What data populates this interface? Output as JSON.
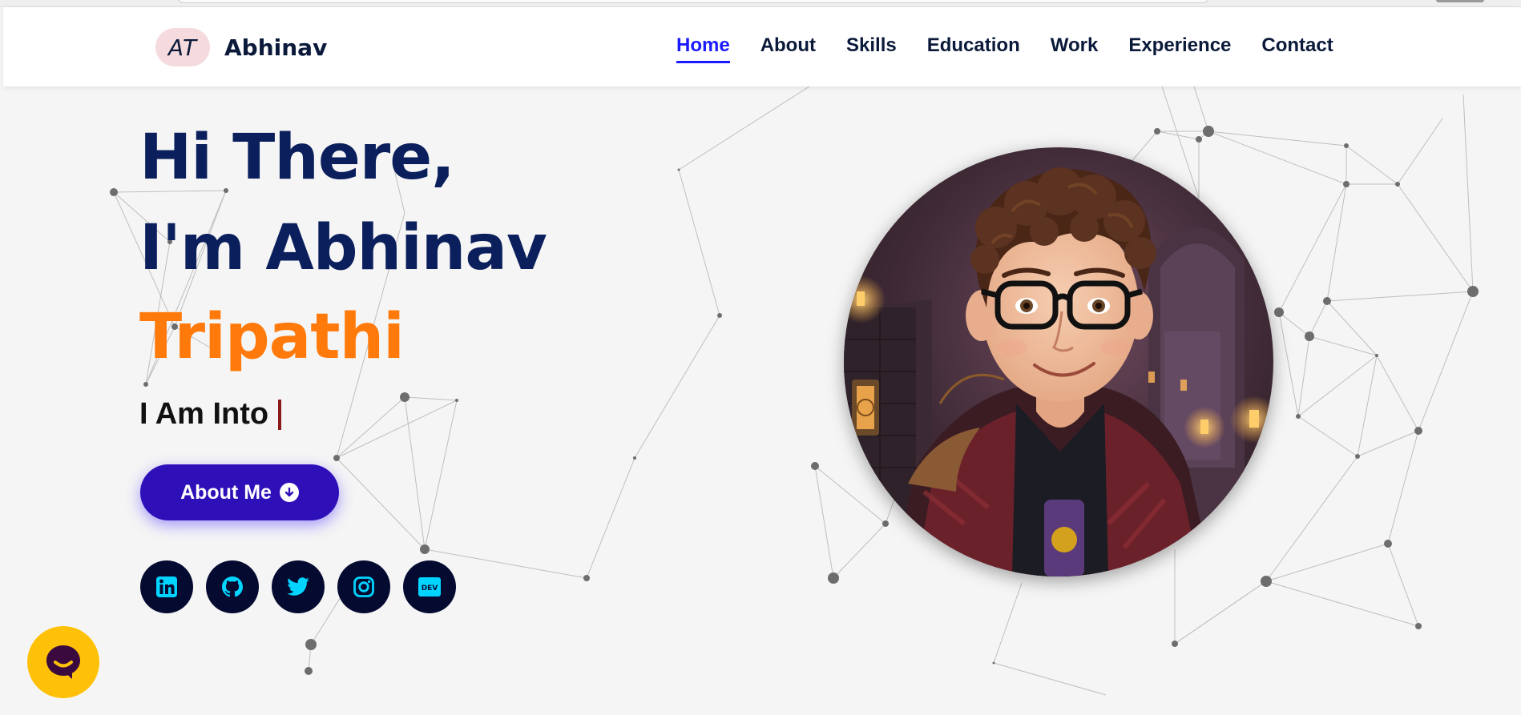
{
  "brand": {
    "initials": "AT",
    "name": "Abhinav"
  },
  "nav": {
    "items": [
      {
        "label": "Home",
        "active": true
      },
      {
        "label": "About",
        "active": false
      },
      {
        "label": "Skills",
        "active": false
      },
      {
        "label": "Education",
        "active": false
      },
      {
        "label": "Work",
        "active": false
      },
      {
        "label": "Experience",
        "active": false
      },
      {
        "label": "Contact",
        "active": false
      }
    ]
  },
  "hero": {
    "line1": "Hi There,",
    "line2": "I'm Abhinav",
    "line3": "Tripathi",
    "typed_prefix": "I Am Into",
    "button_label": "About Me",
    "socials": [
      {
        "icon": "linkedin-icon"
      },
      {
        "icon": "github-icon"
      },
      {
        "icon": "twitter-icon"
      },
      {
        "icon": "instagram-icon"
      },
      {
        "icon": "dev-icon",
        "label": "DEV"
      }
    ]
  },
  "avatar": {
    "icon": "profile-avatar"
  },
  "chat": {
    "icon": "chat-icon"
  },
  "colors": {
    "primary": "#0a1f5c",
    "accent": "#ff7a0b",
    "nav_active": "#1a1aff",
    "button": "#2f0fb8",
    "social_bg": "#050a30",
    "social_icon": "#00d4ff",
    "chat_bg": "#ffc107"
  }
}
